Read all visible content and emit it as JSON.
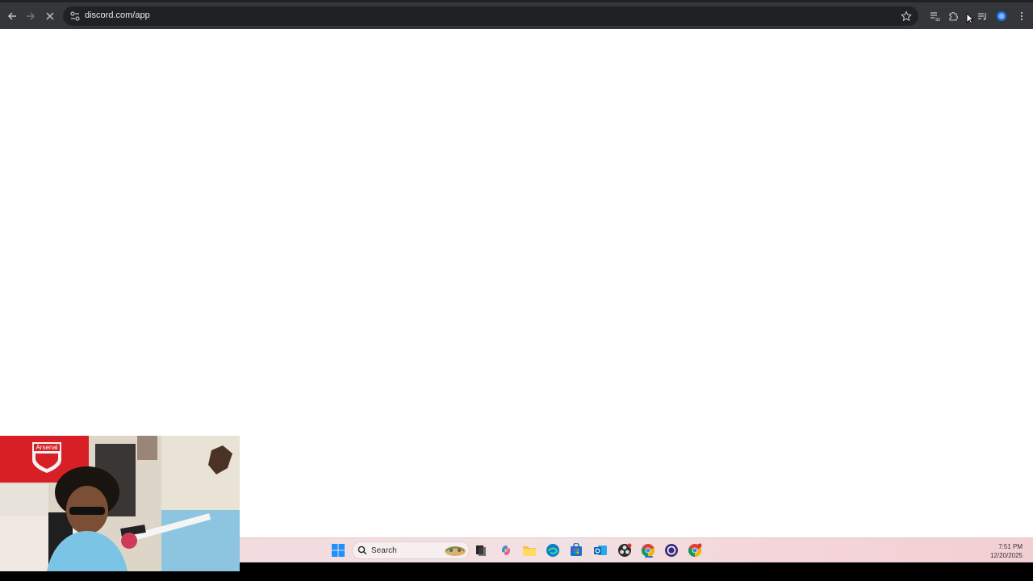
{
  "browser": {
    "url": "discord.com/app",
    "nav": {
      "back": "arrow-left-icon",
      "forward": "arrow-right-icon",
      "stop": "close-icon"
    },
    "extensions": [
      "bookmark-star-icon",
      "extension-sg-icon",
      "puzzle-icon",
      "media-queue-icon",
      "profile-icon",
      "menu-dots-icon"
    ]
  },
  "taskbar": {
    "search_placeholder": "Search",
    "apps": [
      "windows-start-icon",
      "widgets-icon",
      "task-view-icon",
      "copilot-icon",
      "file-explorer-icon",
      "edge-icon",
      "store-icon",
      "outlook-icon",
      "obs-icon",
      "chrome-icon",
      "cortana-ring-icon",
      "chrome-canary-icon"
    ],
    "clock": {
      "time": "7:51 PM",
      "date": "12/20/2025"
    }
  },
  "webcam": {
    "flag_text": "Arsenal"
  },
  "colors": {
    "toolbar": "#35363a",
    "omnibox": "#202124",
    "taskbar": "#f3dde0"
  }
}
